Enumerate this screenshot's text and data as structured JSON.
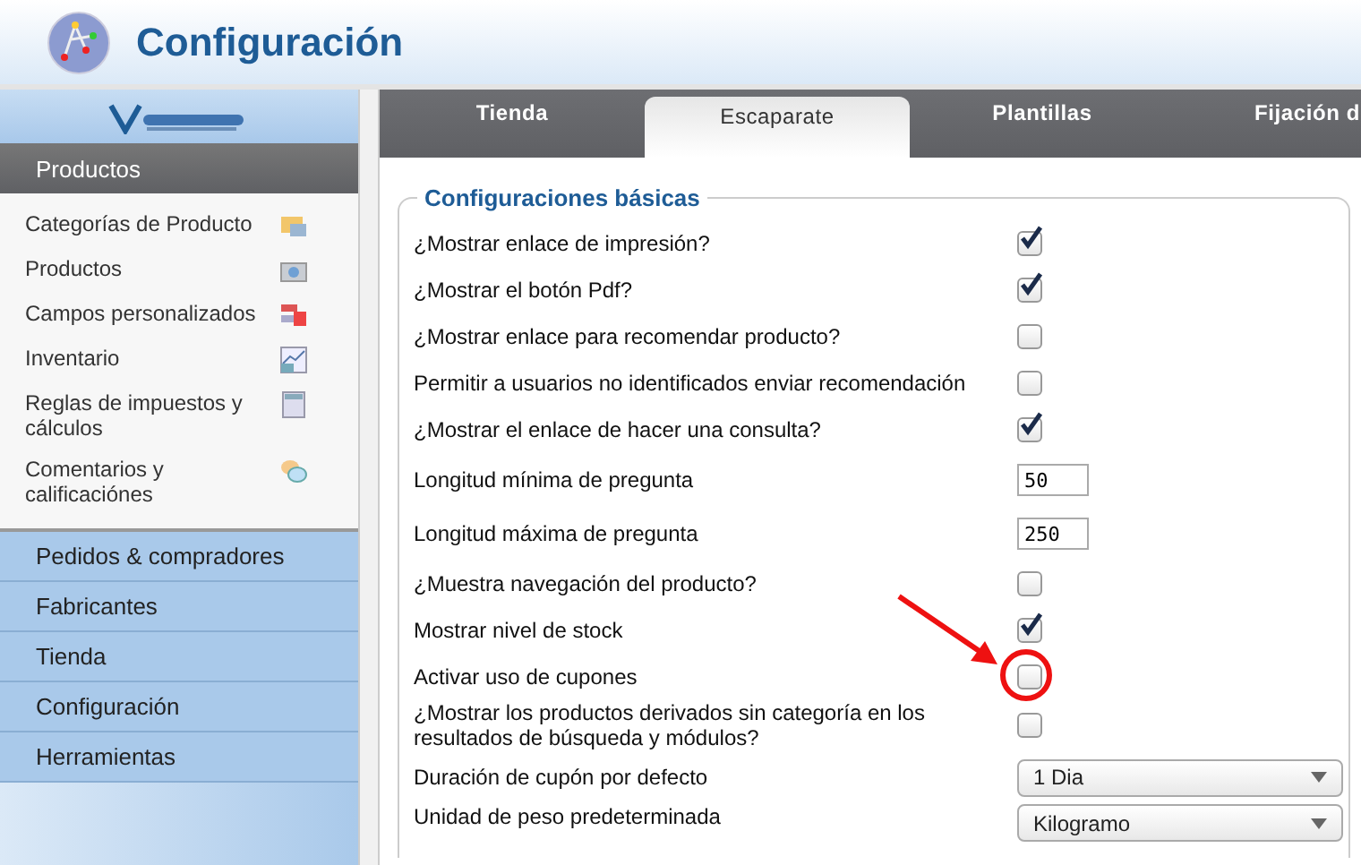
{
  "header": {
    "title": "Configuración"
  },
  "sidebar": {
    "logo": {
      "kind": "picture"
    },
    "section": "Productos",
    "items": [
      {
        "label": "Categorías de Producto"
      },
      {
        "label": "Productos"
      },
      {
        "label": "Campos personalizados"
      },
      {
        "label": "Inventario"
      },
      {
        "label": "Reglas de impuestos y cálculos"
      },
      {
        "label": "Comentarios y calificaciónes"
      }
    ],
    "menu": [
      "Pedidos & compradores",
      "Fabricantes",
      "Tienda",
      "Configuración",
      "Herramientas"
    ]
  },
  "tabs": [
    {
      "label": "Tienda",
      "selected": false
    },
    {
      "label": "Escaparate",
      "selected": true
    },
    {
      "label": "Plantillas",
      "selected": false
    },
    {
      "label": "Fijación d",
      "selected": false
    }
  ],
  "fieldset": {
    "legend": "Configuraciones básicas",
    "rows": [
      {
        "kind": "checkbox",
        "label": "¿Mostrar enlace de impresión?",
        "checked": true
      },
      {
        "kind": "checkbox",
        "label": "¿Mostrar el botón Pdf?",
        "checked": true
      },
      {
        "kind": "checkbox",
        "label": "¿Mostrar enlace para recomendar producto?",
        "checked": false
      },
      {
        "kind": "checkbox",
        "label": "Permitir a usuarios no identificados enviar recomendación",
        "checked": false
      },
      {
        "kind": "checkbox",
        "label": "¿Mostrar el enlace de hacer una consulta?",
        "checked": true
      },
      {
        "kind": "text",
        "label": "Longitud mínima de pregunta",
        "value": "50"
      },
      {
        "kind": "text",
        "label": "Longitud máxima de pregunta",
        "value": "250"
      },
      {
        "kind": "checkbox",
        "label": "¿Muestra navegación del producto?",
        "checked": false
      },
      {
        "kind": "checkbox",
        "label": "Mostrar nivel de stock",
        "checked": true
      },
      {
        "kind": "checkbox",
        "label": "Activar uso de cupones",
        "checked": false,
        "highlighted": true
      },
      {
        "kind": "checkbox",
        "label": "¿Mostrar los productos derivados sin categoría en los resultados de búsqueda y módulos?",
        "checked": false
      },
      {
        "kind": "select",
        "label": "Duración de cupón por defecto",
        "value": "1 Dia"
      },
      {
        "kind": "select",
        "label": "Unidad de peso predeterminada",
        "value": "Kilogramo"
      }
    ]
  }
}
